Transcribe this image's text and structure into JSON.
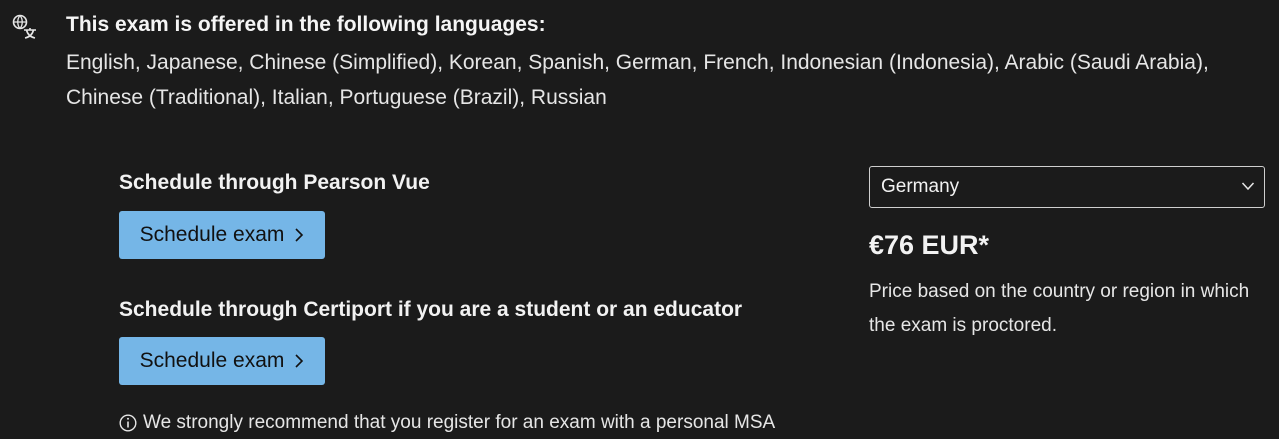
{
  "languages": {
    "icon": "language-translate-icon",
    "heading": "This exam is offered in the following languages:",
    "list": "English, Japanese, Chinese (Simplified), Korean, Spanish, German, French, Indonesian (Indonesia), Arabic (Saudi Arabia), Chinese (Traditional), Italian, Portuguese (Brazil), Russian"
  },
  "pearson": {
    "heading": "Schedule through Pearson Vue",
    "button_label": "Schedule exam"
  },
  "certiport": {
    "heading": "Schedule through Certiport if you are a student or an educator",
    "button_label": "Schedule exam"
  },
  "notice": {
    "icon": "info-icon",
    "text": "We strongly recommend that you register for an exam with a personal MSA"
  },
  "pricing": {
    "country_selected": "Germany",
    "price": "€76 EUR*",
    "note": "Price based on the country or region in which the exam is proctored."
  },
  "colors": {
    "background": "#1b1b1b",
    "button": "#75b6e7",
    "text": "#f2f2f2"
  }
}
